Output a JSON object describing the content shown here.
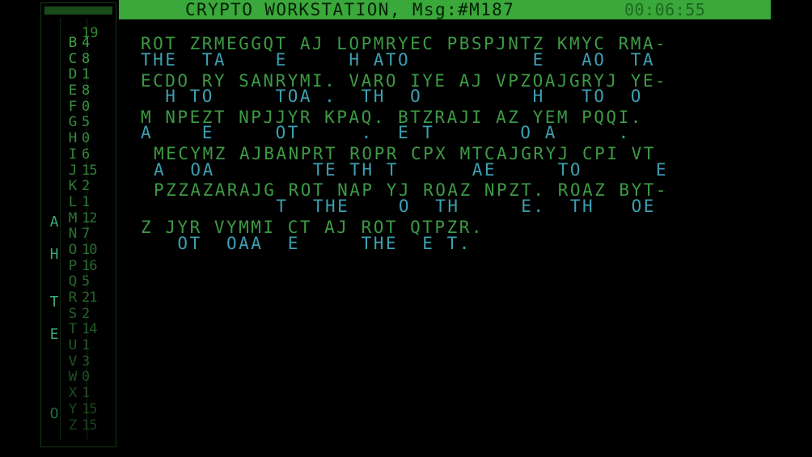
{
  "titlebar": {
    "title": "CRYPTO WORKSTATION, Msg:#M187",
    "timer": "00:06:55"
  },
  "sidebar": {
    "top_count": "19",
    "solved_letters": [
      "A",
      "H",
      "T",
      "E",
      "O"
    ],
    "frequencies": [
      {
        "letter": "B",
        "count": "4"
      },
      {
        "letter": "C",
        "count": "8"
      },
      {
        "letter": "D",
        "count": "1"
      },
      {
        "letter": "E",
        "count": "8"
      },
      {
        "letter": "F",
        "count": "0"
      },
      {
        "letter": "G",
        "count": "5"
      },
      {
        "letter": "H",
        "count": "0"
      },
      {
        "letter": "I",
        "count": "6"
      },
      {
        "letter": "J",
        "count": "15"
      },
      {
        "letter": "K",
        "count": "2"
      },
      {
        "letter": "L",
        "count": "1"
      },
      {
        "letter": "M",
        "count": "12"
      },
      {
        "letter": "N",
        "count": "7"
      },
      {
        "letter": "O",
        "count": "10"
      },
      {
        "letter": "P",
        "count": "16"
      },
      {
        "letter": "Q",
        "count": "5"
      },
      {
        "letter": "R",
        "count": "21"
      },
      {
        "letter": "S",
        "count": "2"
      },
      {
        "letter": "T",
        "count": "14"
      },
      {
        "letter": "U",
        "count": "1"
      },
      {
        "letter": "V",
        "count": "3"
      },
      {
        "letter": "W",
        "count": "0"
      },
      {
        "letter": "X",
        "count": "1"
      },
      {
        "letter": "Y",
        "count": "15"
      },
      {
        "letter": "Z",
        "count": "15"
      }
    ]
  },
  "message": {
    "lines": [
      {
        "cipher": "ROT ZRMEGGQT AJ LOPMRYEC PBSPJNTZ KMYC RMA-",
        "plain": "THE  TA    E     H ATO          E   AO  TA"
      },
      {
        "cipher": "ECDO RY SANRYMI. VARO IYE AJ VPZOAJGRYJ YE-",
        "plain": "  H TO     TOA .  TH  O         H   TO  O"
      },
      {
        "cipher": "M NPEZT NPJJYR KPAQ. BTZRAJI AZ YEM PQQI.",
        "plain": "A    E     OT     .  E T       O A     ."
      },
      {
        "cipher": "MECYMZ AJBANPRT ROPR CPX MTCAJGRYJ CPI VT",
        "plain": "A  OA        TE TH T      AE     TO      E"
      },
      {
        "cipher": "PZZAZARAJG ROT NAP YJ ROAZ NPZT. ROAZ BYT-",
        "plain": "          T  THE    O  TH     E.  TH   OE"
      },
      {
        "cipher": "Z JYR VYMMI CT AJ ROT QTPZR.",
        "plain": "   OT  OAA  E     THE  E T."
      }
    ]
  }
}
